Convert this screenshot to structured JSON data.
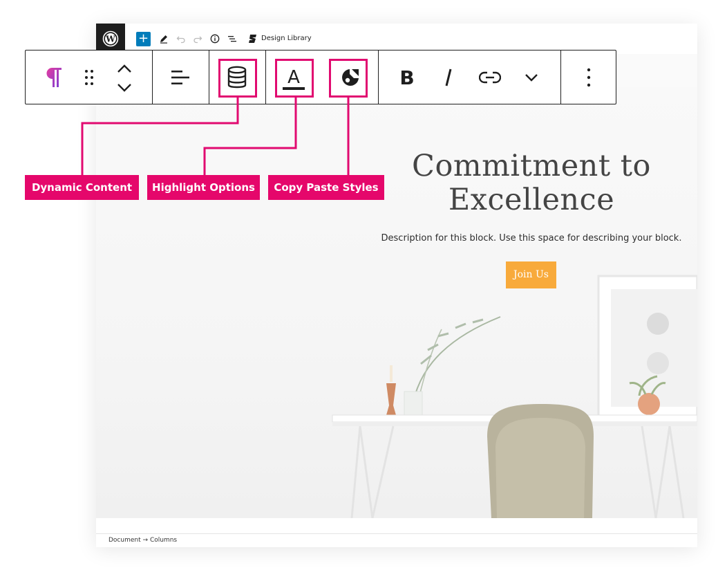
{
  "app": {
    "design_library_label": "Design Library"
  },
  "hero": {
    "title_line1": "Commitment to",
    "title_line2": "Excellence",
    "description": "Description for this block. Use this space for describing your block.",
    "button_label": "Join Us",
    "button_color": "#f8aa3b"
  },
  "breadcrumb": {
    "item1": "Document",
    "arrow": "→",
    "item2": "Columns"
  },
  "toolbar": {
    "icons": [
      "paragraph-icon",
      "drag-handle-icon",
      "move-up-icon",
      "move-down-icon",
      "align-left-icon",
      "dynamic-content-icon",
      "highlight-text-icon",
      "copy-paste-styles-icon",
      "bold-icon",
      "italic-icon",
      "link-icon",
      "more-rich-text-icon",
      "options-icon"
    ]
  },
  "callouts": {
    "dynamic_content": "Dynamic Content",
    "highlight_options": "Highlight Options",
    "copy_paste_styles": "Copy Paste Styles"
  },
  "colors": {
    "accent_pink": "#e5076b",
    "wp_blue": "#007cba",
    "dark": "#1e1e1e"
  }
}
